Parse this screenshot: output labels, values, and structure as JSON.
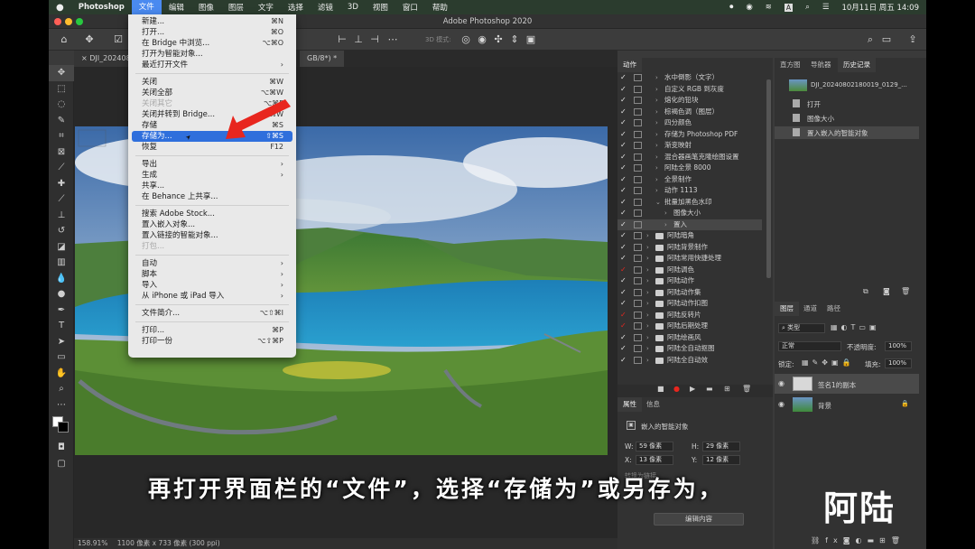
{
  "mac_menubar": {
    "apple": "",
    "items": [
      "Photoshop",
      "文件",
      "编辑",
      "图像",
      "图层",
      "文字",
      "选择",
      "滤镜",
      "3D",
      "视图",
      "窗口",
      "帮助"
    ],
    "clock": "10月11日 周五  14:09",
    "input_badge": "A"
  },
  "window": {
    "title": "Adobe Photoshop 2020"
  },
  "options_bar": {
    "mode3d_label": "3D 模式:"
  },
  "document": {
    "tab1": "DJI_2024080",
    "tab2": "GB/8*) *",
    "zoom": "158.91%",
    "info": "1100 像素 x 733 像素 (300 ppi)"
  },
  "file_menu": {
    "items": [
      {
        "label": "新建...",
        "shortcut": "⌘N"
      },
      {
        "label": "打开...",
        "shortcut": "⌘O"
      },
      {
        "label": "在 Bridge 中浏览...",
        "shortcut": "⌥⌘O"
      },
      {
        "label": "打开为智能对象..."
      },
      {
        "label": "最近打开文件",
        "submenu": true
      },
      {
        "sep": true
      },
      {
        "label": "关闭",
        "shortcut": "⌘W"
      },
      {
        "label": "关闭全部",
        "shortcut": "⌥⌘W"
      },
      {
        "label": "关闭其它",
        "shortcut": "⌥⌘P",
        "disabled": true
      },
      {
        "label": "关闭并转到 Bridge...",
        "shortcut": "⇧⌘W"
      },
      {
        "label": "存储",
        "shortcut": "⌘S"
      },
      {
        "label": "存储为...",
        "shortcut": "⇧⌘S",
        "selected": true
      },
      {
        "label": "恢复",
        "shortcut": "F12"
      },
      {
        "sep": true
      },
      {
        "label": "导出",
        "submenu": true
      },
      {
        "label": "生成",
        "submenu": true
      },
      {
        "label": "共享..."
      },
      {
        "label": "在 Behance 上共享..."
      },
      {
        "sep": true
      },
      {
        "label": "搜索 Adobe Stock..."
      },
      {
        "label": "置入嵌入对象..."
      },
      {
        "label": "置入链接的智能对象..."
      },
      {
        "label": "打包...",
        "disabled": true
      },
      {
        "sep": true
      },
      {
        "label": "自动",
        "submenu": true
      },
      {
        "label": "脚本",
        "submenu": true
      },
      {
        "label": "导入",
        "submenu": true
      },
      {
        "label": "从 iPhone 或 iPad 导入",
        "submenu": true
      },
      {
        "sep": true
      },
      {
        "label": "文件简介...",
        "shortcut": "⌥⇧⌘I"
      },
      {
        "sep": true
      },
      {
        "label": "打印...",
        "shortcut": "⌘P"
      },
      {
        "label": "打印一份",
        "shortcut": "⌥⇧⌘P"
      }
    ]
  },
  "actions_panel": {
    "tab": "动作",
    "rows": [
      {
        "label": "水中倒影（文字）",
        "indent": 2,
        "folder": false
      },
      {
        "label": "自定义 RGB 到灰度",
        "indent": 2,
        "folder": false
      },
      {
        "label": "熔化的铅块",
        "indent": 2,
        "folder": false
      },
      {
        "label": "棕褐色调（图层）",
        "indent": 2,
        "folder": false
      },
      {
        "label": "四分颜色",
        "indent": 2,
        "folder": false
      },
      {
        "label": "存储为 Photoshop PDF",
        "indent": 2,
        "folder": false
      },
      {
        "label": "渐变映射",
        "indent": 2,
        "folder": false
      },
      {
        "label": "混合器画笔克隆绘图设置",
        "indent": 2,
        "folder": false
      },
      {
        "label": "阿陆全景 8000",
        "indent": 2,
        "folder": false
      },
      {
        "label": "全景制作",
        "indent": 2,
        "folder": false
      },
      {
        "label": "动作 1113",
        "indent": 2,
        "folder": false
      },
      {
        "label": "批量加黑色水印",
        "indent": 2,
        "folder": false,
        "open": true
      },
      {
        "label": "图像大小",
        "indent": 3,
        "folder": false
      },
      {
        "label": "置入",
        "indent": 3,
        "folder": false,
        "highlight": true
      },
      {
        "label": "阿陆暗角",
        "indent": 1,
        "folder": true
      },
      {
        "label": "阿陆背景制作",
        "indent": 1,
        "folder": true
      },
      {
        "label": "阿陆常用快捷处理",
        "indent": 1,
        "folder": true
      },
      {
        "label": "阿陆调色",
        "indent": 1,
        "folder": true,
        "red": true
      },
      {
        "label": "阿陆动作",
        "indent": 1,
        "folder": true
      },
      {
        "label": "阿陆动作集",
        "indent": 1,
        "folder": true
      },
      {
        "label": "阿陆动作扣图",
        "indent": 1,
        "folder": true
      },
      {
        "label": "阿陆反转片",
        "indent": 1,
        "folder": true,
        "red": true
      },
      {
        "label": "阿陆后期处理",
        "indent": 1,
        "folder": true,
        "red": true
      },
      {
        "label": "阿陆绘画风",
        "indent": 1,
        "folder": true
      },
      {
        "label": "阿陆全自动抠图",
        "indent": 1,
        "folder": true
      },
      {
        "label": "阿陆全自动效",
        "indent": 1,
        "folder": true
      }
    ]
  },
  "history_panel": {
    "tabs": [
      "直方图",
      "导航器",
      "历史记录"
    ],
    "snapshot": "DJI_20240802180019_0129_...",
    "states": [
      "打开",
      "图像大小",
      "置入嵌入的智能对象"
    ]
  },
  "properties_panel": {
    "tabs": [
      "属性",
      "信息"
    ],
    "type": "嵌入的智能对象",
    "w_label": "W:",
    "w_value": "59 像素",
    "h_label": "H:",
    "h_value": "29 像素",
    "x_label": "X:",
    "x_value": "13 像素",
    "y_label": "Y:",
    "y_value": "12 像素",
    "extra": "转换为链接",
    "edit_button": "编辑内容"
  },
  "layers_panel": {
    "tabs": [
      "图层",
      "通道",
      "路径"
    ],
    "filter": "类型",
    "blend": "正常",
    "opacity_label": "不透明度:",
    "opacity": "100%",
    "lock_label": "锁定:",
    "fill_label": "填充:",
    "fill": "100%",
    "layers": [
      {
        "name": "签名1的副本",
        "selected": true
      },
      {
        "name": "背景",
        "selected": false
      }
    ]
  },
  "caption": "再打开界面栏的“文件”，选择“存储为”或另存为，",
  "watermark": "阿陆",
  "colors": {
    "accent": "#2f6fdc",
    "arrow": "#e8261e",
    "menubar": "#2b3c2e"
  }
}
